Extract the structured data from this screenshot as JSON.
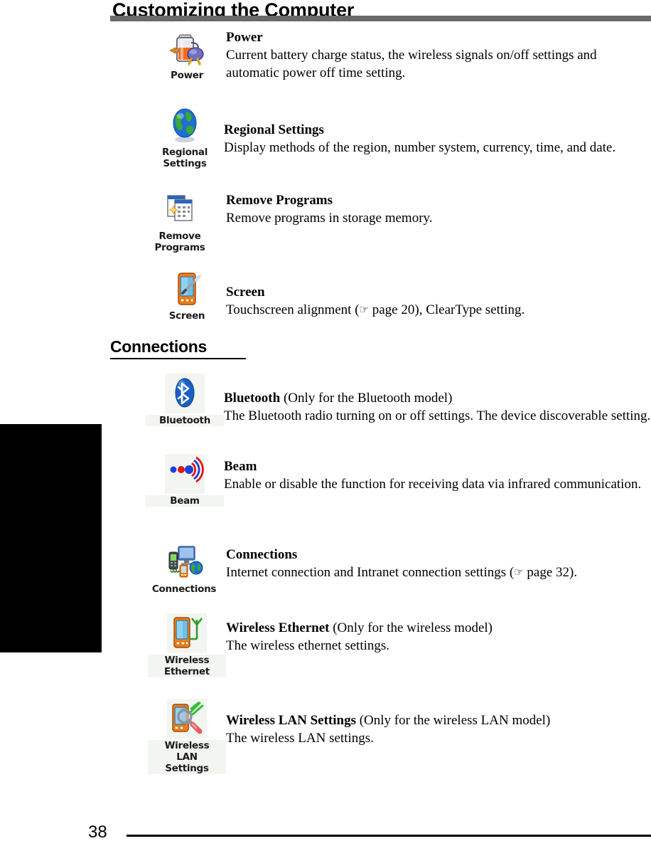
{
  "page": {
    "title": "Customizing the Computer",
    "number": "38"
  },
  "sections": [
    {
      "heading": null,
      "entries": [
        {
          "icon_name": "power-icon",
          "icon_caption": "Power",
          "icon_boxed": false,
          "title": "Power",
          "qualifier": "",
          "description": "Current battery charge status, the wireless signals on/off settings and automatic power off time setting."
        },
        {
          "icon_name": "regional-settings-icon",
          "icon_caption": "Regional\nSettings",
          "icon_boxed": false,
          "title": "Regional Settings",
          "qualifier": "",
          "description": "Display methods of the region, number system, currency, time, and date."
        },
        {
          "icon_name": "remove-programs-icon",
          "icon_caption": "Remove\nPrograms",
          "icon_boxed": false,
          "title": "Remove Programs",
          "qualifier": "",
          "description": "Remove programs in storage memory."
        },
        {
          "icon_name": "screen-icon",
          "icon_caption": "Screen",
          "icon_boxed": false,
          "title": "Screen",
          "qualifier": "",
          "description_pre": "Touchscreen alignment (",
          "description_ref": " page 20)",
          "description_post": ", ClearType setting.",
          "description": "Touchscreen alignment ( page 20), ClearType setting."
        }
      ]
    },
    {
      "heading": "Connections",
      "entries": [
        {
          "icon_name": "bluetooth-icon",
          "icon_caption": "Bluetooth",
          "icon_boxed": true,
          "title": "Bluetooth",
          "qualifier": " (Only for the Bluetooth model)",
          "description": "The Bluetooth radio turning on or off settings. The device discoverable setting."
        },
        {
          "icon_name": "beam-icon",
          "icon_caption": "Beam",
          "icon_boxed": true,
          "title": "Beam",
          "qualifier": "",
          "description": "Enable or disable the function for receiving data via infrared communication."
        },
        {
          "icon_name": "connections-icon",
          "icon_caption": "Connections",
          "icon_boxed": false,
          "title": "Connections",
          "qualifier": "",
          "description_pre": "Internet connection and Intranet connection settings (",
          "description_ref": " page 32)",
          "description_post": ".",
          "description": "Internet connection and Intranet connection settings ( page 32)."
        },
        {
          "icon_name": "wireless-ethernet-icon",
          "icon_caption": "Wireless\nEthernet",
          "icon_boxed": true,
          "title": "Wireless Ethernet",
          "qualifier": " (Only for the wireless model)",
          "description": "The wireless ethernet settings."
        },
        {
          "icon_name": "wireless-lan-settings-icon",
          "icon_caption": "Wireless\nLAN\nSettings",
          "icon_boxed": true,
          "title": "Wireless LAN Settings",
          "qualifier": " (Only for the wireless LAN model)",
          "description": "The wireless LAN settings."
        }
      ]
    }
  ],
  "icons": {
    "page_reference_glyph": "☞"
  },
  "colors": {
    "title_bar_gray": "#6a6a6a",
    "edge_tab_black": "#000000",
    "text_black": "#000000",
    "icon_box_background": "#f2f5f0"
  }
}
